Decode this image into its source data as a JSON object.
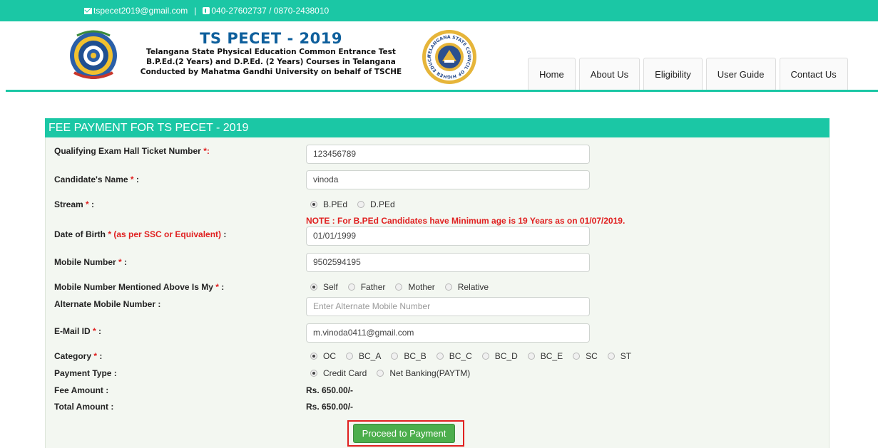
{
  "topbar": {
    "email": "tspecet2019@gmail.com",
    "separator": "|",
    "phone": "040-27602737 / 0870-2438010",
    "email_icon": "mail-icon",
    "phone_icon": "phone-icon"
  },
  "header": {
    "title": "TS PECET - 2019",
    "line1": "Telangana State Physical Education Common Entrance Test",
    "line2": "B.P.Ed.(2 Years) and D.P.Ed. (2 Years) Courses in Telangana",
    "line3": "Conducted by Mahatma Gandhi University on behalf of TSCHE",
    "logo_left": "university-seal-logo",
    "logo_right": "telangana-state-council-logo",
    "logo_right_text": "TELANGANA STATE COUNCIL OF HIGHER EDUCATION"
  },
  "nav": {
    "items": [
      "Home",
      "About Us",
      "Eligibility",
      "User Guide",
      "Contact Us"
    ]
  },
  "form": {
    "heading": "FEE PAYMENT FOR TS PECET - 2019",
    "hall_ticket": {
      "label": "Qualifying Exam Hall Ticket Number ",
      "req": "*:",
      "value": "123456789"
    },
    "name": {
      "label": "Candidate's Name ",
      "req": "*",
      "suffix": " :",
      "value": "vinoda"
    },
    "stream": {
      "label": "Stream ",
      "req": "*",
      "suffix": " :",
      "options": [
        "B.PEd",
        "D.PEd"
      ],
      "selected": "B.PEd"
    },
    "note": "NOTE : For B.PEd Candidates have Minimum age is 19 Years as on 01/07/2019.",
    "dob": {
      "label": "Date of Birth ",
      "req": "* (as per SSC or Equivalent)",
      "suffix": " :",
      "value": "01/01/1999"
    },
    "mobile": {
      "label": "Mobile Number ",
      "req": "*",
      "suffix": " :",
      "value": "9502594195"
    },
    "mobile_owner": {
      "label": "Mobile Number Mentioned Above Is My ",
      "req": "*",
      "suffix": " :",
      "options": [
        "Self",
        "Father",
        "Mother",
        "Relative"
      ],
      "selected": "Self"
    },
    "alt_mobile": {
      "label": "Alternate Mobile Number :",
      "placeholder": "Enter Alternate Mobile Number"
    },
    "email": {
      "label": "E-Mail ID ",
      "req": "*",
      "suffix": " :",
      "value": "m.vinoda0411@gmail.com"
    },
    "category": {
      "label": "Category ",
      "req": "*",
      "suffix": " :",
      "options": [
        "OC",
        "BC_A",
        "BC_B",
        "BC_C",
        "BC_D",
        "BC_E",
        "SC",
        "ST"
      ],
      "selected": "OC"
    },
    "payment_type": {
      "label": "Payment Type :",
      "options": [
        "Credit Card",
        "Net Banking(PAYTM)"
      ],
      "selected": "Credit Card"
    },
    "fee_amount": {
      "label": "Fee Amount :",
      "value": "Rs. 650.00/-"
    },
    "total_amount": {
      "label": "Total Amount :",
      "value": "Rs. 650.00/-"
    },
    "submit_label": "Proceed to Payment"
  },
  "colors": {
    "accent": "#1bc7a5",
    "title_blue": "#0e5f9c",
    "required_red": "#e02020",
    "button_green": "#4cae4c",
    "highlight_red": "#e0201f"
  }
}
